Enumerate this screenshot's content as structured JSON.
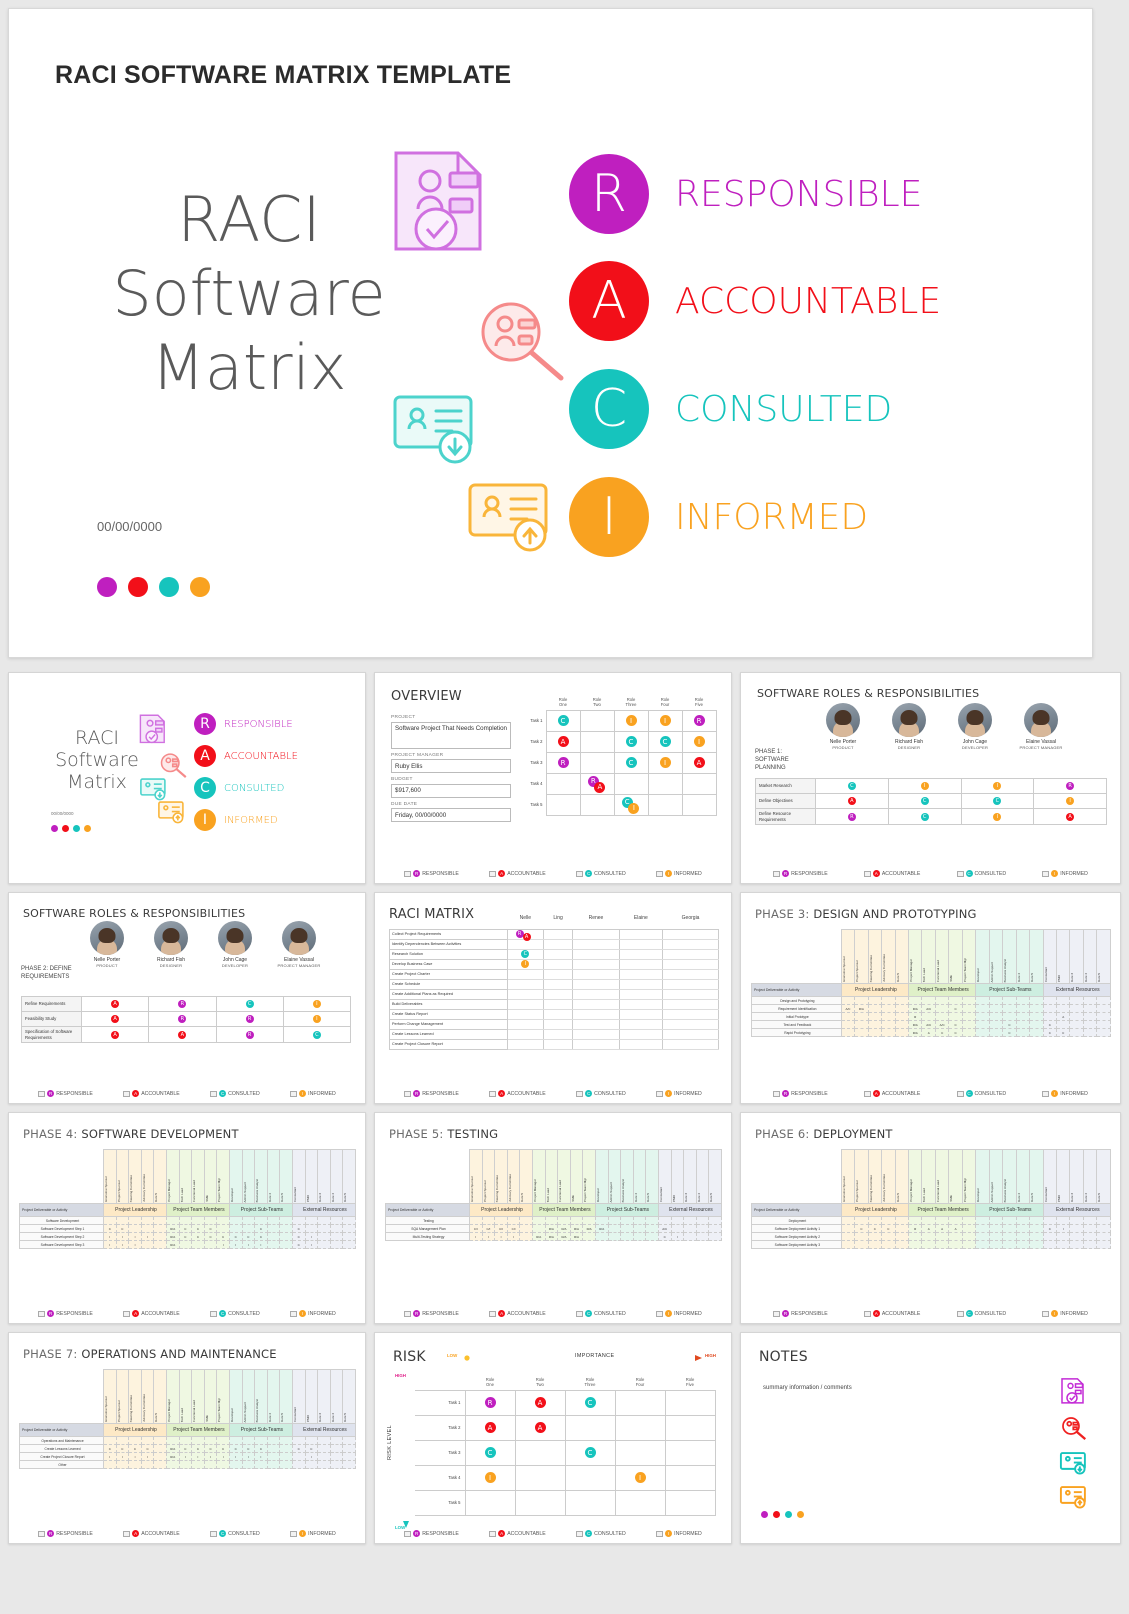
{
  "colors": {
    "responsible": "#bf1fbf",
    "accountable": "#f20f19",
    "consulted": "#16c4bd",
    "informed": "#f9a220",
    "title_gray": "#2b2b2b"
  },
  "hero": {
    "title": "RACI SOFTWARE MATRIX TEMPLATE",
    "big_lines": [
      "RACI",
      "Software",
      "Matrix"
    ],
    "date": "00/00/0000",
    "legend": [
      {
        "letter": "R",
        "label": "RESPONSIBLE",
        "color": "#bf1fbf"
      },
      {
        "letter": "A",
        "label": "ACCOUNTABLE",
        "color": "#f20f19"
      },
      {
        "letter": "C",
        "label": "CONSULTED",
        "color": "#16c4bd"
      },
      {
        "letter": "I",
        "label": "INFORMED",
        "color": "#f9a220"
      }
    ],
    "icons": [
      "document-check-icon",
      "person-search-icon",
      "id-card-download-icon",
      "id-card-upload-icon"
    ]
  },
  "legend_bar": [
    {
      "letter": "R",
      "label": "RESPONSIBLE",
      "color": "#bf1fbf"
    },
    {
      "letter": "A",
      "label": "ACCOUNTABLE",
      "color": "#f20f19"
    },
    {
      "letter": "C",
      "label": "CONSULTED",
      "color": "#16c4bd"
    },
    {
      "letter": "I",
      "label": "INFORMED",
      "color": "#f9a220"
    }
  ],
  "slides": {
    "cover": {
      "big_lines": [
        "RACI",
        "Software",
        "Matrix"
      ],
      "date": "00/00/0000",
      "legend": [
        {
          "letter": "R",
          "label": "RESPONSIBLE",
          "color": "#bf1fbf"
        },
        {
          "letter": "A",
          "label": "ACCOUNTABLE",
          "color": "#f20f19"
        },
        {
          "letter": "C",
          "label": "CONSULTED",
          "color": "#16c4bd"
        },
        {
          "letter": "I",
          "label": "INFORMED",
          "color": "#f9a220"
        }
      ]
    },
    "overview": {
      "title": "OVERVIEW",
      "fields": [
        {
          "label": "PROJECT",
          "value": "Software Project That Needs Completion"
        },
        {
          "label": "PROJECT MANAGER",
          "value": "Ruby Ellis"
        },
        {
          "label": "BUDGET",
          "value": "$917,600"
        },
        {
          "label": "DUE DATE",
          "value": "Friday, 00/00/0000"
        }
      ],
      "columns": [
        "Role One",
        "Role Two",
        "Role Three",
        "Role Four",
        "Role Five"
      ],
      "rows": [
        "Task 1",
        "Task 2",
        "Task 3",
        "Task 4",
        "Task 5"
      ],
      "cells": [
        [
          "C",
          "",
          "I",
          "I",
          "R"
        ],
        [
          "A",
          "",
          "C",
          "C",
          "I"
        ],
        [
          "R",
          "",
          "C",
          "I",
          "A"
        ],
        [
          "",
          "RA",
          "",
          "",
          ""
        ],
        [
          "",
          "",
          "CI",
          "",
          ""
        ]
      ]
    },
    "phase1": {
      "title": "SOFTWARE ROLES & RESPONSIBILITIES",
      "phase_label": "PHASE 1: SOFTWARE PLANNING",
      "people": [
        {
          "name": "Nelle Porter",
          "role": "PRODUCT"
        },
        {
          "name": "Richard Fish",
          "role": "DESIGNER"
        },
        {
          "name": "John Cage",
          "role": "DEVELOPER"
        },
        {
          "name": "Elaine Vassal",
          "role": "PROJECT MANAGER"
        }
      ],
      "rows": [
        {
          "activity": "Market Research",
          "cells": [
            "C",
            "I",
            "I",
            "R"
          ]
        },
        {
          "activity": "Define Objectives",
          "cells": [
            "A",
            "C",
            "C",
            "I"
          ]
        },
        {
          "activity": "Define Resource Requirements",
          "cells": [
            "R",
            "C",
            "I",
            "A"
          ]
        }
      ]
    },
    "phase2": {
      "title": "SOFTWARE ROLES & RESPONSIBILITIES",
      "phase_label": "PHASE 2: DEFINE REQUIREMENTS",
      "people": [
        {
          "name": "Nelle Porter",
          "role": "PRODUCT"
        },
        {
          "name": "Richard Fish",
          "role": "DESIGNER"
        },
        {
          "name": "John Cage",
          "role": "DEVELOPER"
        },
        {
          "name": "Elaine Vassal",
          "role": "PROJECT MANAGER"
        }
      ],
      "rows": [
        {
          "activity": "Refine Requirements",
          "cells": [
            "A",
            "R",
            "C",
            "I"
          ]
        },
        {
          "activity": "Feasibility Study",
          "cells": [
            "A",
            "R",
            "R",
            "I"
          ]
        },
        {
          "activity": "Specification of Software Requirements",
          "cells": [
            "A",
            "A",
            "R",
            "C"
          ]
        }
      ]
    },
    "raci_matrix": {
      "title": "RACI MATRIX",
      "columns": [
        "Nelle",
        "Ling",
        "Renee",
        "Elaine",
        "Georgia"
      ],
      "rows": [
        {
          "activity": "Collect Project Requirements",
          "cells": [
            "RA",
            "",
            "",
            "",
            ""
          ]
        },
        {
          "activity": "Identify Dependencies Between Activities",
          "cells": [
            "",
            "",
            "",
            "",
            ""
          ]
        },
        {
          "activity": "Research Solution",
          "cells": [
            "C",
            "",
            "",
            "",
            ""
          ]
        },
        {
          "activity": "Develop Business Case",
          "cells": [
            "I",
            "",
            "",
            "",
            ""
          ]
        },
        {
          "activity": "Create Project Charter",
          "cells": [
            "",
            "",
            "",
            "",
            ""
          ]
        },
        {
          "activity": "Create Schedule",
          "cells": [
            "",
            "",
            "",
            "",
            ""
          ]
        },
        {
          "activity": "Create Additional Plans as Required",
          "cells": [
            "",
            "",
            "",
            "",
            ""
          ]
        },
        {
          "activity": "Build Deliverables",
          "cells": [
            "",
            "",
            "",
            "",
            ""
          ]
        },
        {
          "activity": "Create Status Report",
          "cells": [
            "",
            "",
            "",
            "",
            ""
          ]
        },
        {
          "activity": "Perform Change Management",
          "cells": [
            "",
            "",
            "",
            "",
            ""
          ]
        },
        {
          "activity": "Create Lessons Learned",
          "cells": [
            "",
            "",
            "",
            "",
            ""
          ]
        },
        {
          "activity": "Create Project Closure Report",
          "cells": [
            "",
            "",
            "",
            "",
            ""
          ]
        }
      ]
    },
    "phase_common": {
      "row_header": "Project Deliverable or Activity",
      "groups": [
        {
          "name": "Project Leadership",
          "cols": [
            "Executive Sponsor",
            "Project Sponsor",
            "Steering Committee",
            "Advisory Committee",
            "Role 5"
          ]
        },
        {
          "name": "Project Team Members",
          "cols": [
            "Project Manager",
            "Tech Lead",
            "Functional Lead",
            "SME",
            "Project Team Mgr"
          ]
        },
        {
          "name": "Project Sub-Teams",
          "cols": [
            "Developer",
            "Admin Support",
            "Business Analyst",
            "Role 4",
            "Role 5"
          ]
        },
        {
          "name": "External Resources",
          "cols": [
            "Consultant",
            "PMO",
            "Role 3",
            "Role 4",
            "Role 5"
          ]
        }
      ]
    },
    "phase3": {
      "title_prefix": "PHASE 3:",
      "title": "DESIGN AND PROTOTYPING",
      "rows": [
        {
          "activity": "Design and Prototyping",
          "cells": [
            "",
            "",
            "",
            "",
            "",
            "",
            "",
            "",
            "",
            "",
            "",
            "",
            "",
            "",
            "",
            "",
            "",
            "",
            "",
            ""
          ]
        },
        {
          "activity": "Requirement Identification",
          "cells": [
            "A/C",
            "R/A",
            "",
            "",
            "",
            "R/A",
            "A/C",
            "",
            "C",
            "",
            "",
            "",
            "",
            "",
            "",
            "",
            "",
            "",
            "",
            ""
          ]
        },
        {
          "activity": "Initial Prototype",
          "cells": [
            "",
            "",
            "",
            "",
            "",
            "R",
            "",
            "",
            "",
            "",
            "",
            "",
            "",
            "",
            "",
            "",
            "A",
            "",
            "",
            ""
          ]
        },
        {
          "activity": "Test and Feedback",
          "cells": [
            "",
            "",
            "",
            "",
            "",
            "R/A",
            "A/C",
            "A/C",
            "C",
            "",
            "",
            "",
            "C",
            "",
            "",
            "C",
            "",
            "",
            "",
            ""
          ]
        },
        {
          "activity": "Rapid Prototyping",
          "cells": [
            "",
            "",
            "",
            "",
            "",
            "R/A",
            "A",
            "C",
            "C",
            "",
            "",
            "",
            "C",
            "",
            "",
            "C",
            "C",
            "",
            "",
            ""
          ]
        }
      ]
    },
    "phase4": {
      "title_prefix": "PHASE 4:",
      "title": "SOFTWARE DEVELOPMENT",
      "rows": [
        {
          "activity": "Software Development",
          "cells": [
            "",
            "",
            "",
            "",
            "",
            "",
            "",
            "",
            "",
            "",
            "",
            "",
            "",
            "",
            "",
            "",
            "",
            "",
            "",
            ""
          ]
        },
        {
          "activity": "Software Development Step 1",
          "cells": [
            "C",
            "C",
            "",
            "",
            "",
            "R/A",
            "C",
            "C",
            "C",
            "",
            "",
            "",
            "C",
            "",
            "",
            "C",
            "",
            "",
            "",
            ""
          ]
        },
        {
          "activity": "Software Development Step 2",
          "cells": [
            "I",
            "I",
            "I",
            "I",
            "",
            "R/A",
            "C",
            "C",
            "C",
            "C",
            "C",
            "C",
            "C",
            "",
            "",
            "C",
            "I",
            "",
            "",
            ""
          ]
        },
        {
          "activity": "Software Development Step 3",
          "cells": [
            "I",
            "I",
            "I",
            "",
            "",
            "R/A",
            "",
            "",
            "",
            "I",
            "I",
            "I",
            "I",
            "",
            "",
            "C",
            "I",
            "",
            "",
            ""
          ]
        }
      ]
    },
    "phase5": {
      "title_prefix": "PHASE 5:",
      "title": "TESTING",
      "rows": [
        {
          "activity": "Testing",
          "cells": [
            "",
            "",
            "",
            "",
            "",
            "",
            "",
            "",
            "",
            "",
            "",
            "",
            "",
            "",
            "",
            "",
            "",
            "",
            "",
            ""
          ]
        },
        {
          "activity": "SQA Management Plan",
          "cells": [
            "C/I",
            "C/I",
            "C/I",
            "C/I",
            "",
            "",
            "R/A",
            "R/A",
            "R/A",
            "R/A",
            "R/A",
            "",
            "",
            "",
            "",
            "A/C",
            "",
            "",
            "",
            ""
          ]
        },
        {
          "activity": "Multi-Testing Strategy",
          "cells": [
            "I",
            "I",
            "I",
            "I",
            "",
            "R/A",
            "R/A",
            "R/A",
            "R/A",
            "",
            "",
            "",
            "",
            "",
            "",
            "C",
            "I",
            "",
            "",
            ""
          ]
        }
      ]
    },
    "phase6": {
      "title_prefix": "PHASE 6:",
      "title": "DEPLOYMENT",
      "rows": [
        {
          "activity": "Deployment",
          "cells": [
            "",
            "",
            "",
            "",
            "",
            "",
            "",
            "",
            "",
            "",
            "",
            "",
            "",
            "",
            "",
            "",
            "",
            "",
            "",
            ""
          ]
        },
        {
          "activity": "Software Deployment Activity 1",
          "cells": [
            "",
            "C",
            "C",
            "C",
            "",
            "R",
            "A",
            "A",
            "A",
            "",
            "",
            "",
            "",
            "",
            "",
            "C",
            "I",
            "",
            "",
            ""
          ]
        },
        {
          "activity": "Software Deployment Activity 2",
          "cells": [
            "",
            "",
            "",
            "",
            "",
            "",
            "",
            "",
            "",
            "",
            "",
            "",
            "",
            "",
            "",
            "",
            "",
            "",
            "",
            ""
          ]
        },
        {
          "activity": "Software Deployment Activity 3",
          "cells": [
            "",
            "",
            "",
            "",
            "",
            "",
            "",
            "",
            "",
            "",
            "",
            "",
            "",
            "",
            "",
            "",
            "",
            "",
            "",
            ""
          ]
        }
      ]
    },
    "phase7": {
      "title_prefix": "PHASE 7:",
      "title": "OPERATIONS AND MAINTENANCE",
      "rows": [
        {
          "activity": "Operations and Maintenance",
          "cells": [
            "",
            "",
            "",
            "",
            "",
            "",
            "",
            "",
            "",
            "",
            "",
            "",
            "",
            "",
            "",
            "",
            "",
            "",
            "",
            ""
          ]
        },
        {
          "activity": "Create Lessons Learned",
          "cells": [
            "C",
            "C",
            "C",
            "C",
            "",
            "R/A",
            "C",
            "C",
            "C",
            "C",
            "C",
            "C",
            "C",
            "",
            "",
            "C",
            "C",
            "",
            "",
            ""
          ]
        },
        {
          "activity": "Create Project Closure Report",
          "cells": [
            "I",
            "I",
            "I",
            "I",
            "",
            "R/A",
            "I",
            "I",
            "I",
            "I",
            "I",
            "I",
            "I",
            "",
            "",
            "",
            "I",
            "",
            "",
            ""
          ]
        },
        {
          "activity": "Other",
          "cells": [
            "",
            "",
            "",
            "",
            "",
            "",
            "",
            "",
            "",
            "",
            "",
            "",
            "",
            "",
            "",
            "",
            "",
            "",
            "",
            ""
          ]
        }
      ]
    },
    "risk": {
      "title": "RISK",
      "x_axis": {
        "label": "IMPORTANCE",
        "low": "LOW",
        "high": "HIGH"
      },
      "y_axis": {
        "label": "RISK LEVEL",
        "high": "HIGH",
        "low": "LOW"
      },
      "columns": [
        "Role One",
        "Role Two",
        "Role Three",
        "Role Four",
        "Role Five"
      ],
      "rows": [
        "Task 1",
        "Task 2",
        "Task 3",
        "Task 4",
        "Task 5"
      ],
      "cells": [
        [
          "R",
          "A",
          "C",
          "",
          ""
        ],
        [
          "A",
          "A",
          "",
          "",
          ""
        ],
        [
          "C",
          "",
          "C",
          "",
          ""
        ],
        [
          "I",
          "",
          "",
          "I",
          ""
        ],
        [
          "",
          "",
          "",
          "",
          ""
        ]
      ]
    },
    "notes": {
      "title": "NOTES",
      "placeholder": "summary information / comments",
      "icons": [
        "document-check-icon",
        "person-search-icon",
        "id-card-download-icon",
        "id-card-upload-icon"
      ]
    }
  }
}
